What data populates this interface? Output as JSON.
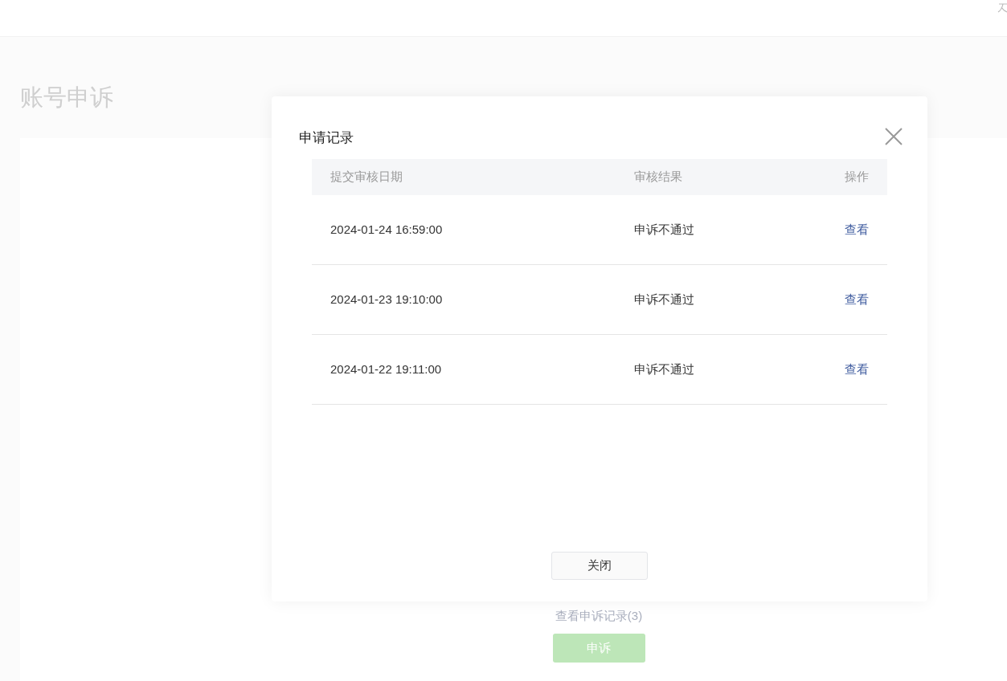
{
  "page": {
    "title": "账号申诉",
    "records_link": "查看申诉记录(3)",
    "appeal_button": "申诉"
  },
  "dialog": {
    "title": "申请记录",
    "columns": [
      "提交审核日期",
      "审核结果",
      "操作"
    ],
    "rows": [
      {
        "date": "2024-01-24 16:59:00",
        "result": "申诉不通过",
        "action": "查看"
      },
      {
        "date": "2024-01-23 19:10:00",
        "result": "申诉不通过",
        "action": "查看"
      },
      {
        "date": "2024-01-22 19:11:00",
        "result": "申诉不通过",
        "action": "查看"
      }
    ],
    "close_button": "关闭"
  }
}
